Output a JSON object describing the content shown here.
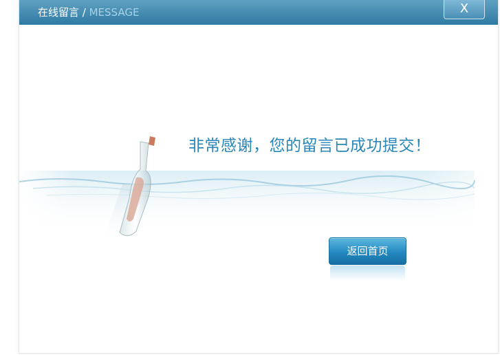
{
  "header": {
    "title_cn": "在线留言",
    "separator": " / ",
    "title_en": "MESSAGE",
    "close_label": "X"
  },
  "main": {
    "message": "非常感谢，您的留言已成功提交！",
    "home_button_label": "返回首页"
  },
  "colors": {
    "header": "#3f87ad",
    "accent_text": "#2a86b8",
    "button": "#2389c0"
  },
  "icons": {
    "illustration": "message-in-bottle"
  }
}
